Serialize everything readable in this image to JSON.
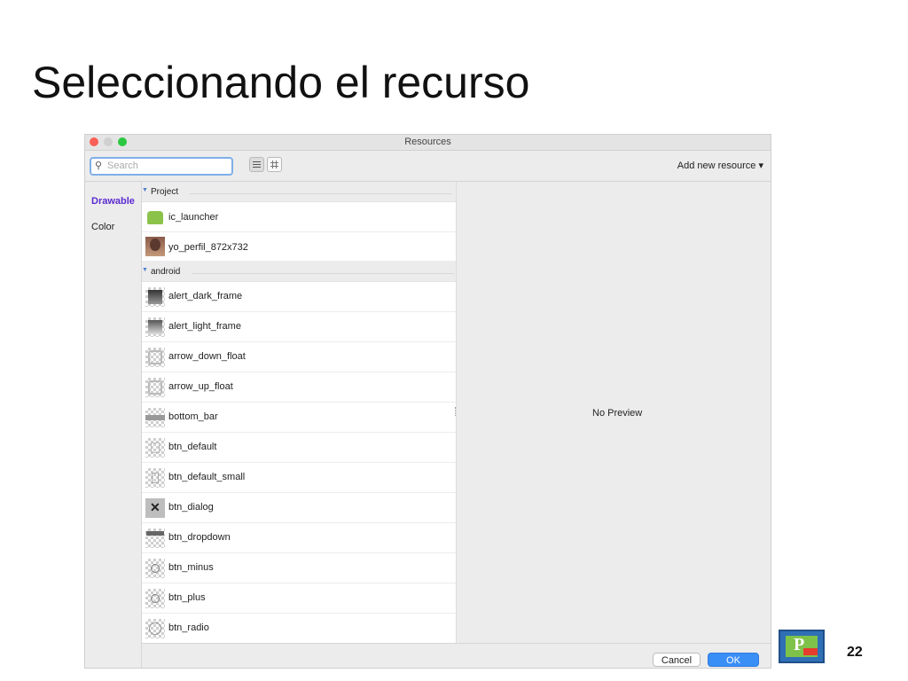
{
  "slide": {
    "title": "Seleccionando el recurso",
    "page_number": "22",
    "logo_text": "P"
  },
  "window": {
    "title": "Resources",
    "search": {
      "placeholder": "Search",
      "value": ""
    },
    "add_new_resource": "Add new resource ▾",
    "sidebar": {
      "items": [
        {
          "label": "Drawable",
          "selected": true
        },
        {
          "label": "Color",
          "selected": false
        }
      ]
    },
    "groups": [
      {
        "label": "Project",
        "items": [
          {
            "name": "ic_launcher",
            "icon": "android-robot-icon"
          },
          {
            "name": "yo_perfil_872x732",
            "icon": "photo-thumbnail-icon"
          }
        ]
      },
      {
        "label": "android",
        "items": [
          {
            "name": "alert_dark_frame",
            "icon": "dark-frame-icon"
          },
          {
            "name": "alert_light_frame",
            "icon": "light-frame-icon"
          },
          {
            "name": "arrow_down_float",
            "icon": "arrow-down-icon"
          },
          {
            "name": "arrow_up_float",
            "icon": "arrow-up-icon"
          },
          {
            "name": "bottom_bar",
            "icon": "bar-icon"
          },
          {
            "name": "btn_default",
            "icon": "button-icon"
          },
          {
            "name": "btn_default_small",
            "icon": "button-small-icon"
          },
          {
            "name": "btn_dialog",
            "icon": "close-icon"
          },
          {
            "name": "btn_dropdown",
            "icon": "dropdown-icon"
          },
          {
            "name": "btn_minus",
            "icon": "minus-icon"
          },
          {
            "name": "btn_plus",
            "icon": "plus-icon"
          },
          {
            "name": "btn_radio",
            "icon": "radio-icon"
          }
        ]
      }
    ],
    "preview_text": "No Preview",
    "cancel_label": "Cancel",
    "ok_label": "OK",
    "colors": {
      "accent": "#3a8ff7",
      "selected_sidebar": "#5b2bd1"
    }
  }
}
